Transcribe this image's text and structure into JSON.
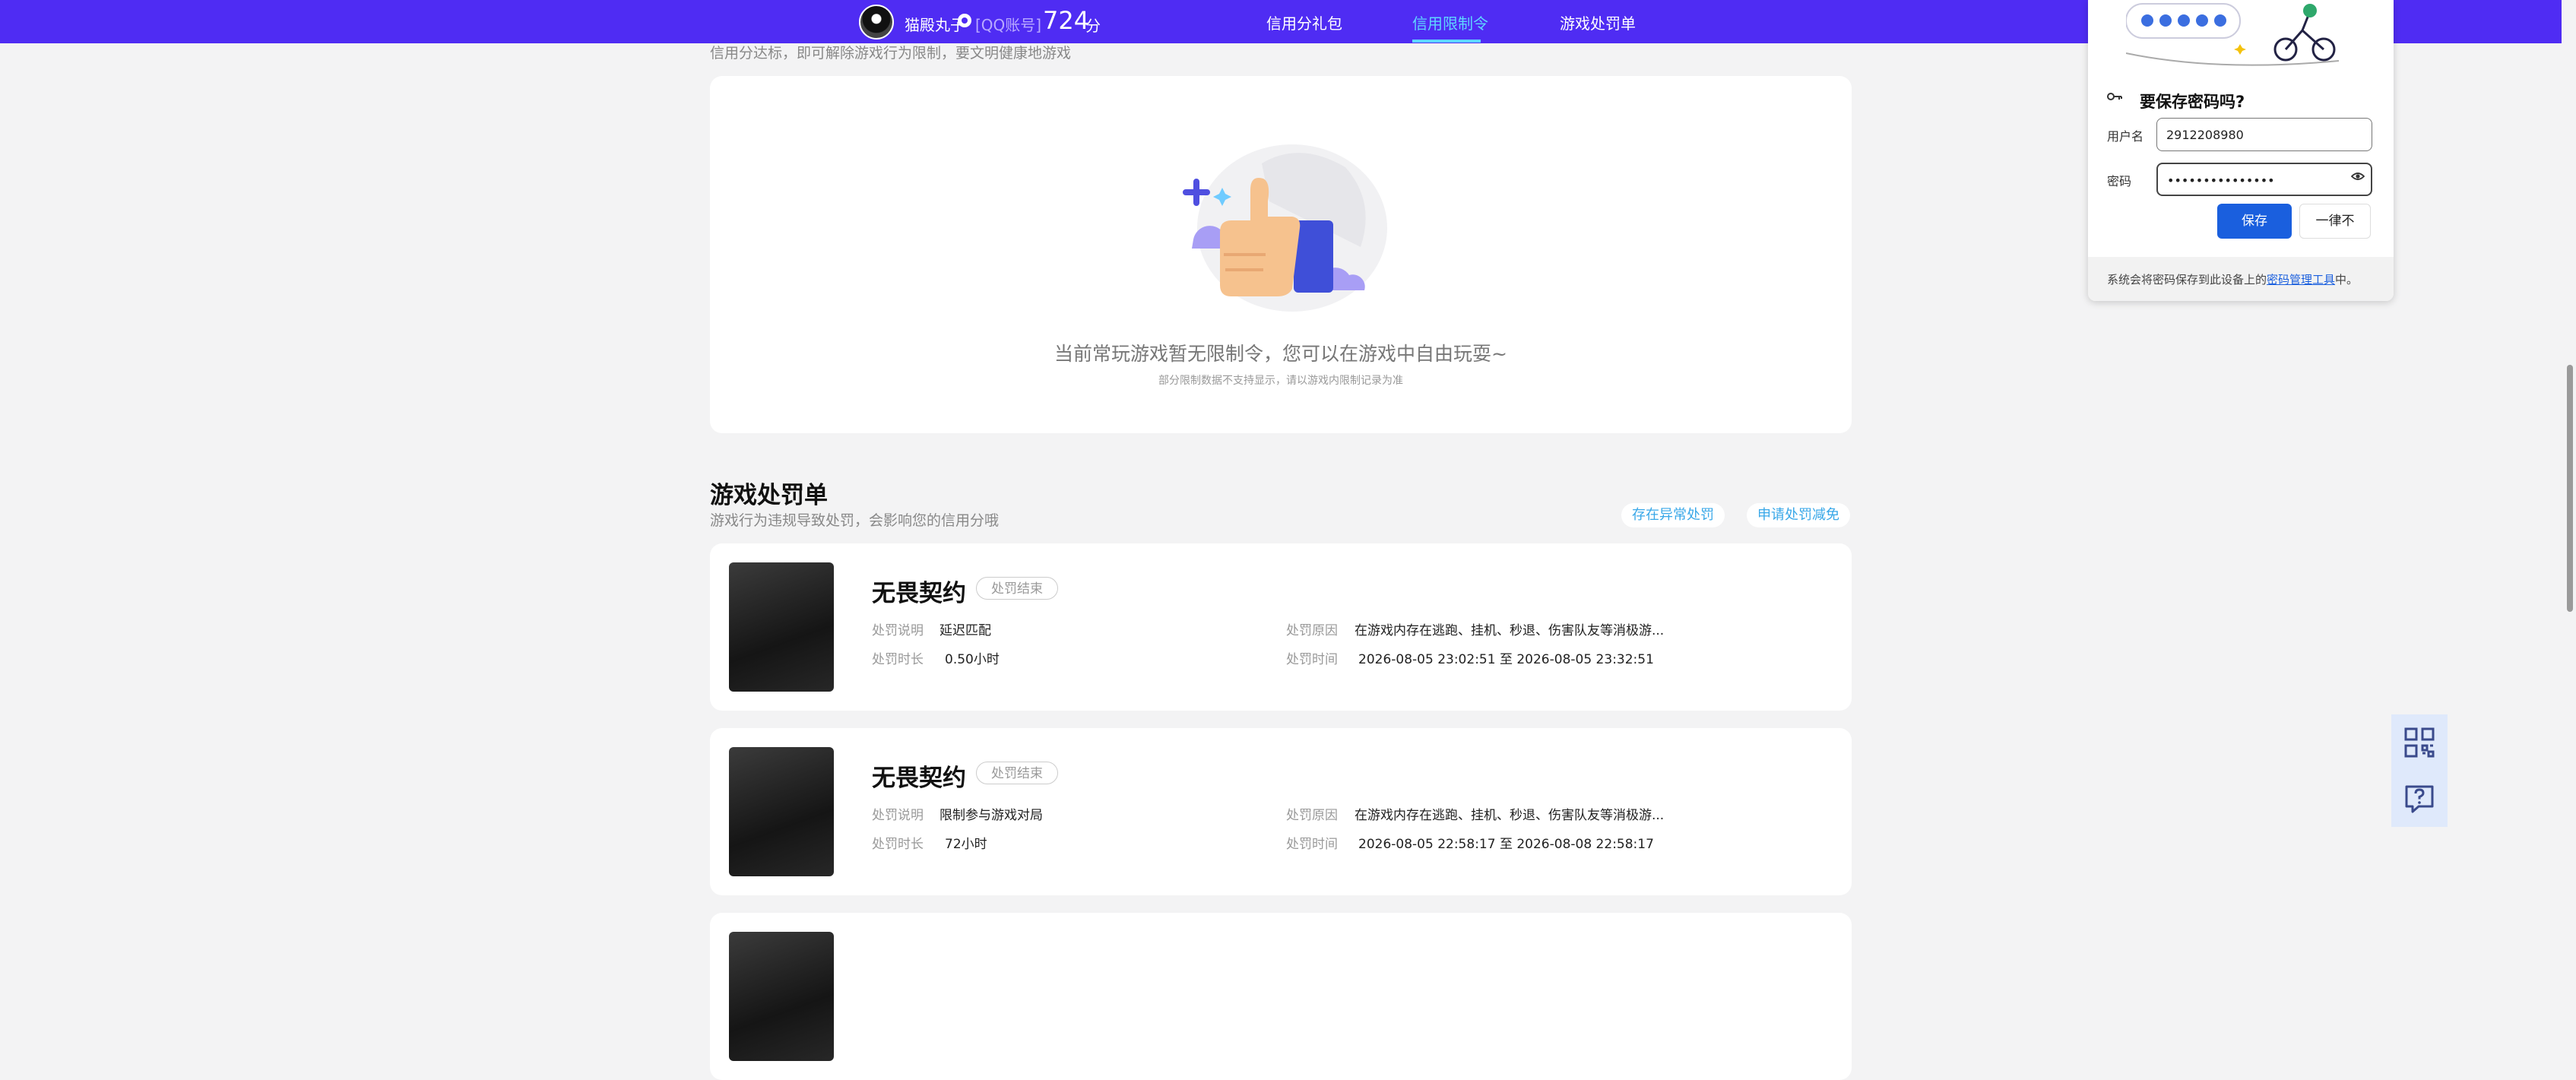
{
  "header": {
    "user_name": "猫殿丸子",
    "qq_label": "[QQ账号]",
    "score": "724",
    "score_unit": "分",
    "tabs": [
      {
        "label": "信用分礼包",
        "active": false
      },
      {
        "label": "信用限制令",
        "active": true
      },
      {
        "label": "游戏处罚单",
        "active": false
      }
    ]
  },
  "credit_section": {
    "description": "信用分达标，即可解除游戏行为限制，要文明健康地游戏",
    "empty_title": "当前常玩游戏暂无限制令，您可以在游戏中自由玩耍~",
    "empty_subtitle": "部分限制数据不支持显示，请以游戏内限制记录为准"
  },
  "penalty_section": {
    "title": "游戏处罚单",
    "description": "游戏行为违规导致处罚，会影响您的信用分哦",
    "buttons": [
      "存在异常处罚",
      "申请处罚减免"
    ],
    "field_labels": {
      "desc": "处罚说明",
      "duration": "处罚时长",
      "reason": "处罚原因",
      "time": "处罚时间"
    },
    "records": [
      {
        "game": "无畏契约",
        "status": "处罚结束",
        "desc": "延迟匹配",
        "duration": "0.50小时",
        "reason": "在游戏内存在逃跑、挂机、秒退、伤害队友等消极游...",
        "time": "2026-08-05 23:02:51 至 2026-08-05 23:32:51"
      },
      {
        "game": "无畏契约",
        "status": "处罚结束",
        "desc": "限制参与游戏对局",
        "duration": "72小时",
        "reason": "在游戏内存在逃跑、挂机、秒退、伤害队友等消极游...",
        "time": "2026-08-05 22:58:17 至 2026-08-08 22:58:17"
      }
    ]
  },
  "password_popup": {
    "title": "要保存密码吗?",
    "username_label": "用户名",
    "username_value": "2912208980",
    "password_label": "密码",
    "password_value": "•••••••••••••••",
    "save_label": "保存",
    "never_label": "一律不",
    "footer_prefix": "系统会将密码保存到此设备上的",
    "footer_link": "密码管理工具",
    "footer_suffix": "中。"
  },
  "icons": {
    "qr": "qr-code-icon",
    "help": "help-chat-icon",
    "key": "key-icon",
    "eye": "eye-icon"
  },
  "colors": {
    "header_bg": "#4f2cf3",
    "active_tab": "#5fd6ff",
    "primary_button": "#1a5fde"
  }
}
